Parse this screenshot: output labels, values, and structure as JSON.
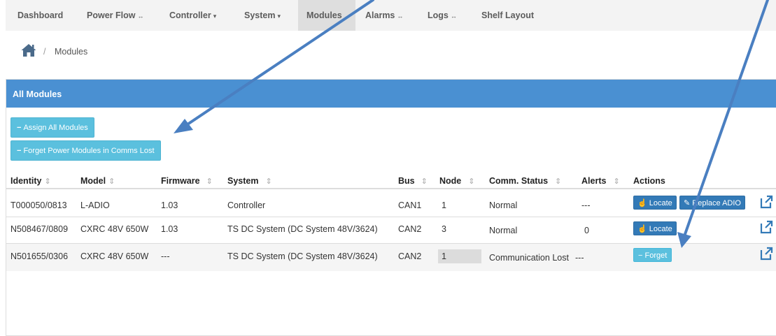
{
  "nav": {
    "dashboard": "Dashboard",
    "power_flow": "Power Flow",
    "controller": "Controller",
    "system": "System",
    "modules": "Modules",
    "alarms": "Alarms",
    "logs": "Logs",
    "shelf_layout": "Shelf Layout",
    "caret": "▾",
    "caret_ind": "↔"
  },
  "breadcrumb": {
    "home_icon": "home-icon",
    "separator": "/",
    "current": "Modules"
  },
  "panel": {
    "title": "All Modules",
    "assign_all": "Assign All Modules",
    "forget_lost": "Forget Power Modules in Comms Lost",
    "minus": "−"
  },
  "table": {
    "headers": {
      "identity": "Identity",
      "model": "Model",
      "firmware": "Firmware",
      "system": "System",
      "bus": "Bus",
      "node": "Node",
      "comm_status": "Comm. Status",
      "alerts": "Alerts",
      "actions": "Actions"
    },
    "sort_icon": "⇕",
    "rows": [
      {
        "identity": "T000050/0813",
        "model": "L-ADIO",
        "firmware": "1.03",
        "system": "Controller",
        "bus": "CAN1",
        "node": "1",
        "comm_status": "Normal",
        "alerts": "---",
        "actions": [
          "Locate",
          "Replace ADIO"
        ]
      },
      {
        "identity": "N508467/0809",
        "model": "CXRC 48V 650W",
        "firmware": "1.03",
        "system": "TS DC System (DC System 48V/3624)",
        "bus": "CAN2",
        "node": "3",
        "comm_status": "Normal",
        "alerts": "0",
        "actions": [
          "Locate"
        ]
      },
      {
        "identity": "N501655/0306",
        "model": "CXRC 48V 650W",
        "firmware": "---",
        "system": "TS DC System (DC System 48V/3624)",
        "bus": "CAN2",
        "node": "1",
        "comm_status": "Communication Lost",
        "alerts": "---",
        "actions": [
          "Forget"
        ]
      }
    ]
  },
  "icons": {
    "locate": "hand-pointer-icon",
    "replace": "wrench-icon",
    "forget": "minus-icon",
    "external": "external-link-icon"
  },
  "colors": {
    "panel_heading": "#4a90d2",
    "info_button": "#5bc0de",
    "primary_button": "#337ab7",
    "annotation_arrow": "#4a7fc1"
  }
}
